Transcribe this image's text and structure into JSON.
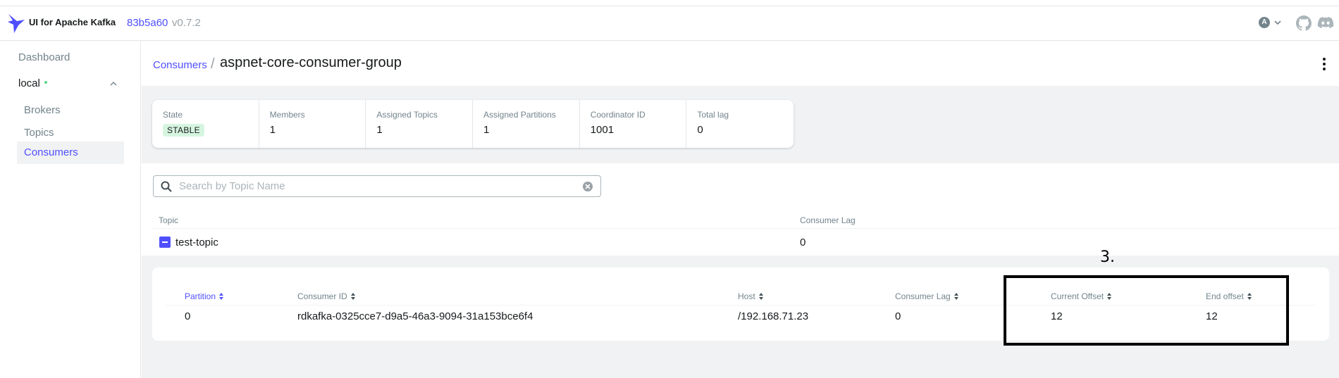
{
  "topbar": {
    "brand": "UI for Apache Kafka",
    "version_hash": "83b5a60",
    "version": "v0.7.2",
    "user_initial": "A",
    "icons": [
      "logo-icon",
      "chevron-down-icon",
      "github-icon",
      "discord-icon"
    ]
  },
  "sidebar": {
    "dashboard": "Dashboard",
    "cluster": "local",
    "items": [
      {
        "label": "Brokers"
      },
      {
        "label": "Topics"
      },
      {
        "label": "Consumers"
      }
    ]
  },
  "breadcrumb": {
    "parent": "Consumers",
    "separator": "/",
    "title": "aspnet-core-consumer-group"
  },
  "stats": [
    {
      "label": "State",
      "value": "STABLE"
    },
    {
      "label": "Members",
      "value": "1"
    },
    {
      "label": "Assigned Topics",
      "value": "1"
    },
    {
      "label": "Assigned Partitions",
      "value": "1"
    },
    {
      "label": "Coordinator ID",
      "value": "1001"
    },
    {
      "label": "Total lag",
      "value": "0"
    }
  ],
  "search": {
    "placeholder": "Search by Topic Name",
    "value": ""
  },
  "topics_table": {
    "headers": [
      "Topic",
      "Consumer Lag"
    ],
    "rows": [
      {
        "topic": "test-topic",
        "lag": "0"
      }
    ]
  },
  "partitions_table": {
    "headers": [
      "Partition",
      "Consumer ID",
      "Host",
      "Consumer Lag",
      "Current Offset",
      "End offset"
    ],
    "rows": [
      {
        "partition": "0",
        "consumer_id": "rdkafka-0325cce7-d9a5-46a3-9094-31a153bce6f4",
        "host": "/192.168.71.23",
        "lag": "0",
        "current_offset": "12",
        "end_offset": "12"
      }
    ]
  },
  "annotation": {
    "label": "3."
  },
  "colors": {
    "accent": "#4f4fff",
    "stable_badge": "#d6f5e0",
    "background": "#f1f2f3"
  }
}
